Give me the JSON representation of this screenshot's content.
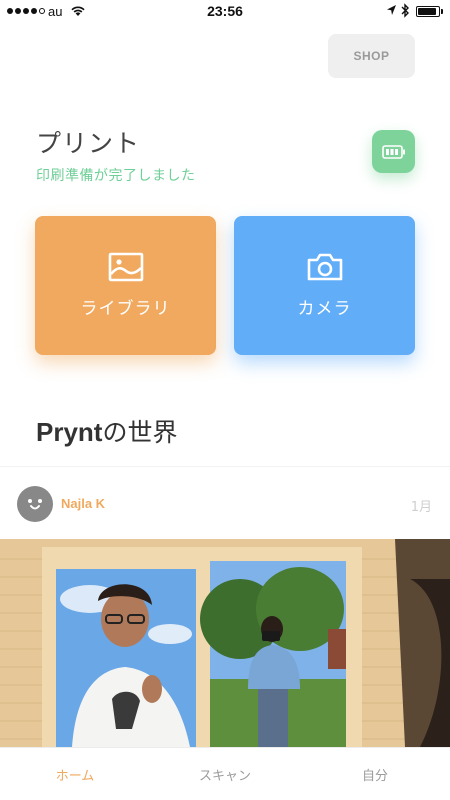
{
  "status_bar": {
    "carrier": "au",
    "time": "23:56"
  },
  "header": {
    "shop_label": "SHOP"
  },
  "print": {
    "title": "プリント",
    "status": "印刷準備が完了しました"
  },
  "actions": {
    "library_label": "ライブラリ",
    "camera_label": "カメラ"
  },
  "world": {
    "brand": "Prynt",
    "suffix": "の世界"
  },
  "post": {
    "author": "Najla K",
    "date": "1月"
  },
  "tabs": [
    {
      "label": "ホーム",
      "active": true
    },
    {
      "label": "スキャン",
      "active": false
    },
    {
      "label": "自分",
      "active": false
    }
  ],
  "colors": {
    "accent_orange": "#f0a95e",
    "accent_blue": "#62adf8",
    "status_green": "#6fcf97",
    "printer_battery_green": "#7ed39b"
  },
  "icons": {
    "library": "image-frame-icon",
    "camera": "camera-icon",
    "printer_battery": "battery-icon",
    "avatar": "smiley-face-icon"
  }
}
